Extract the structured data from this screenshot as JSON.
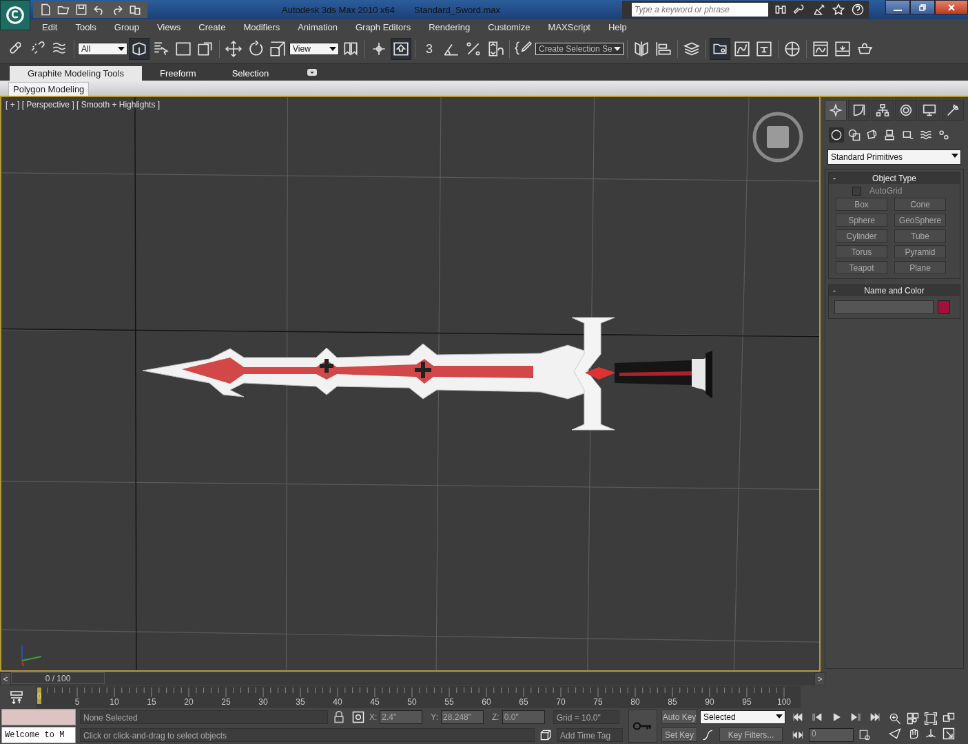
{
  "title_bar": {
    "app_title": "Autodesk 3ds Max  2010 x64",
    "file_name": "Standard_Sword.max",
    "search_placeholder": "Type a keyword or phrase"
  },
  "menu": [
    "Edit",
    "Tools",
    "Group",
    "Views",
    "Create",
    "Modifiers",
    "Animation",
    "Graph Editors",
    "Rendering",
    "Customize",
    "MAXScript",
    "Help"
  ],
  "toolbar": {
    "selection_filter": "All",
    "reference_coordinate": "View",
    "snap_value": "3",
    "named_selection": "Create Selection Se",
    "buttons": [
      {
        "selected": false
      },
      {
        "selected": false
      },
      {
        "selected": false
      },
      {
        "selected": true
      },
      {
        "selected": false
      },
      {
        "selected": false
      },
      {
        "selected": false
      },
      {
        "selected": false
      },
      {
        "selected": false
      },
      {
        "selected": false
      },
      {
        "selected": false
      },
      {
        "selected": false
      },
      {
        "selected": true
      },
      {
        "selected": false
      },
      {
        "selected": false
      },
      {
        "selected": false
      },
      {
        "selected": false
      },
      {
        "selected": false
      },
      {
        "selected": false
      },
      {
        "selected": false
      },
      {
        "selected": true
      },
      {
        "selected": false
      },
      {
        "selected": false
      },
      {
        "selected": false
      },
      {
        "selected": false
      },
      {
        "selected": false
      },
      {
        "selected": false
      }
    ]
  },
  "ribbon": {
    "tabs": [
      {
        "label": "Graphite Modeling Tools",
        "selected": true
      },
      {
        "label": "Freeform",
        "selected": false
      },
      {
        "label": "Selection",
        "selected": false
      }
    ],
    "panel": "Polygon Modeling"
  },
  "viewport": {
    "label": "[ + ] [ Perspective ] [ Smooth + Highlights ]"
  },
  "command_panel": {
    "tabs": [
      {
        "selected": true
      },
      {
        "selected": false
      },
      {
        "selected": false
      },
      {
        "selected": false
      },
      {
        "selected": false
      },
      {
        "selected": false
      }
    ],
    "categories": [
      {
        "selected": true
      },
      {
        "selected": false
      },
      {
        "selected": false
      },
      {
        "selected": false
      },
      {
        "selected": false
      },
      {
        "selected": false
      },
      {
        "selected": false
      }
    ],
    "dropdown": "Standard Primitives",
    "object_type": {
      "title": "Object Type",
      "collapse": "-",
      "autogrid": {
        "label": "AutoGrid",
        "checked": false
      },
      "buttons": [
        "Box",
        "Cone",
        "Sphere",
        "GeoSphere",
        "Cylinder",
        "Tube",
        "Torus",
        "Pyramid",
        "Teapot",
        "Plane"
      ]
    },
    "name_and_color": {
      "title": "Name and Color",
      "collapse": "-",
      "color": "#a0103c"
    }
  },
  "timeline": {
    "prev": "<",
    "position": "0 / 100",
    "next": ">",
    "frame_marker": "0",
    "tick_labels": [
      "5",
      "10",
      "15",
      "20",
      "25",
      "30",
      "35",
      "40",
      "45",
      "50",
      "55",
      "60",
      "65",
      "70",
      "75",
      "80",
      "85",
      "90",
      "95",
      "100"
    ]
  },
  "status": {
    "listener": "Welcome to M",
    "selection": "None Selected",
    "prompt": "Click or click-and-drag to select objects",
    "x_label": "X:",
    "x": "2.4\"",
    "y_label": "Y:",
    "y": "28.248\"",
    "z_label": "Z:",
    "z": "0.0\"",
    "grid": "Grid = 10.0\"",
    "time_tag": "Add Time Tag",
    "auto_key": "Auto Key",
    "set_key": "Set Key",
    "key_mode": "Selected",
    "key_filters": "Key Filters...",
    "frame": "0"
  }
}
